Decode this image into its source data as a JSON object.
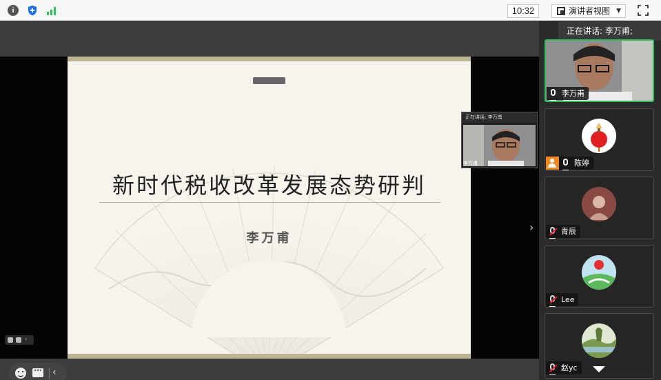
{
  "toolbar": {
    "time": "10:32",
    "view_label": "演讲者视图",
    "icons": [
      "info-icon",
      "shield-icon",
      "signal-icon",
      "layout-icon",
      "chevron-down-icon",
      "fullscreen-icon"
    ],
    "accent_colors": {
      "shield": "#1a73e8",
      "signal": "#2fbf5a"
    }
  },
  "speaking": {
    "label": "正在讲话: 李万甫;"
  },
  "slide": {
    "title": "新时代税收改革发展态势研判",
    "author": "李万甫"
  },
  "floating_video": {
    "header": "正在讲话: 李万甫",
    "name": "李万甫"
  },
  "participants": [
    {
      "name": "李万甫",
      "state": "active",
      "mic": "on"
    },
    {
      "name": "陈婷",
      "state": "normal",
      "mic": "on",
      "role": "host"
    },
    {
      "name": "青辰",
      "state": "normal",
      "mic": "muted"
    },
    {
      "name": "Lee",
      "state": "normal",
      "mic": "muted"
    },
    {
      "name": "赵yc",
      "state": "normal",
      "mic": "muted"
    }
  ],
  "colors": {
    "active_border": "#2fbf5a",
    "host_badge": "#f08a1e",
    "panel_bg": "#2b2b2b",
    "slide_bg": "#f6f4ec",
    "slide_border": "#bdb592"
  }
}
